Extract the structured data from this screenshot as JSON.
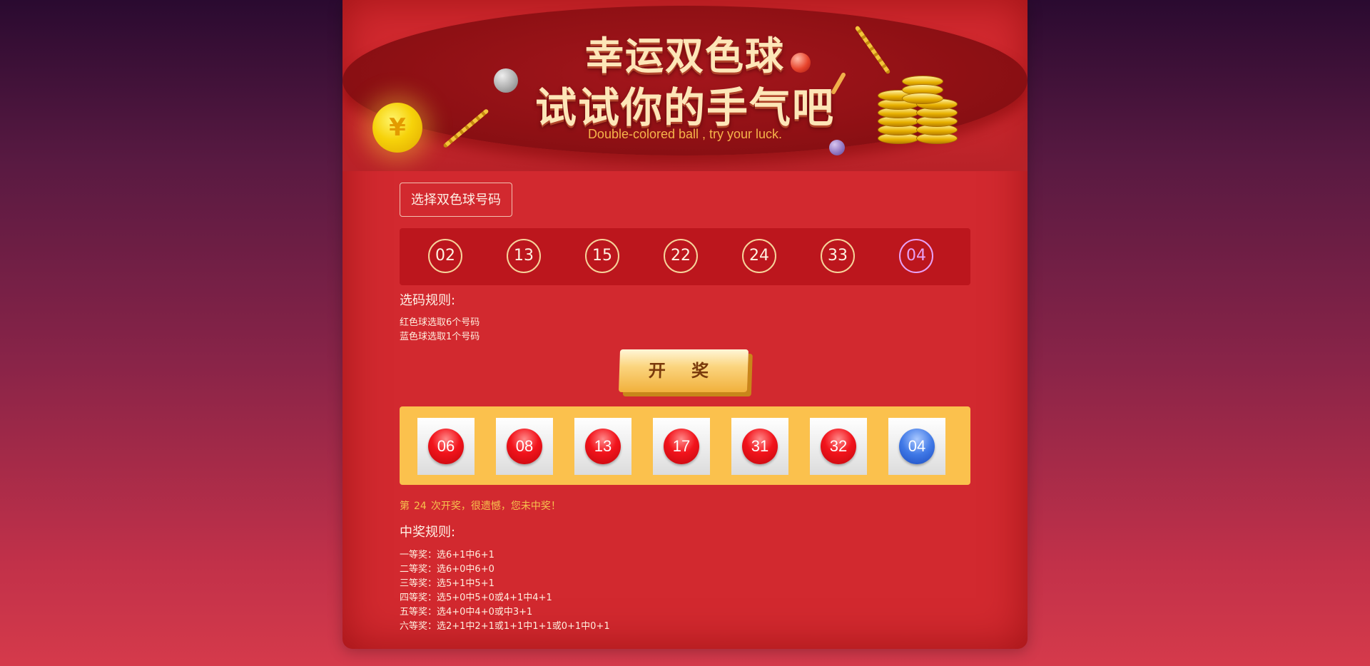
{
  "banner": {
    "title_line1": "幸运双色球",
    "title_line2": "试试你的手气吧",
    "subtitle": "Double-colored ball , try your luck.",
    "coin_symbol": "¥"
  },
  "select_button_label": "选择双色球号码",
  "picked_numbers": [
    {
      "value": "02",
      "color": "red"
    },
    {
      "value": "13",
      "color": "red"
    },
    {
      "value": "15",
      "color": "red"
    },
    {
      "value": "22",
      "color": "red"
    },
    {
      "value": "24",
      "color": "red"
    },
    {
      "value": "33",
      "color": "red"
    },
    {
      "value": "04",
      "color": "blue"
    }
  ],
  "selection_rules": {
    "title": "选码规则:",
    "lines": [
      "红色球选取6个号码",
      "蓝色球选取1个号码"
    ]
  },
  "draw_button_label": "开 奖",
  "drawn_numbers": [
    {
      "value": "06",
      "color": "red"
    },
    {
      "value": "08",
      "color": "red"
    },
    {
      "value": "13",
      "color": "red"
    },
    {
      "value": "17",
      "color": "red"
    },
    {
      "value": "31",
      "color": "red"
    },
    {
      "value": "32",
      "color": "red"
    },
    {
      "value": "04",
      "color": "blue"
    }
  ],
  "result_message": {
    "prefix": "第",
    "count": "24",
    "suffix": "次开奖，很遗憾，您未中奖！"
  },
  "prize_rules": {
    "title": "中奖规则:",
    "lines": [
      "一等奖：选6+1中6+1",
      "二等奖：选6+0中6+0",
      "三等奖：选5+1中5+1",
      "四等奖：选5+0中5+0或4+1中4+1",
      "五等奖：选4+0中4+0或中3+1",
      "六等奖：选2+1中2+1或1+1中1+1或0+1中0+1"
    ]
  },
  "colors": {
    "card_red": "#d2292f",
    "banner_red": "#8e1014",
    "gold": "#fbc14d",
    "red_ball": "#f2141c",
    "blue_ball": "#3f78e6",
    "result_text": "#f6c24e"
  }
}
